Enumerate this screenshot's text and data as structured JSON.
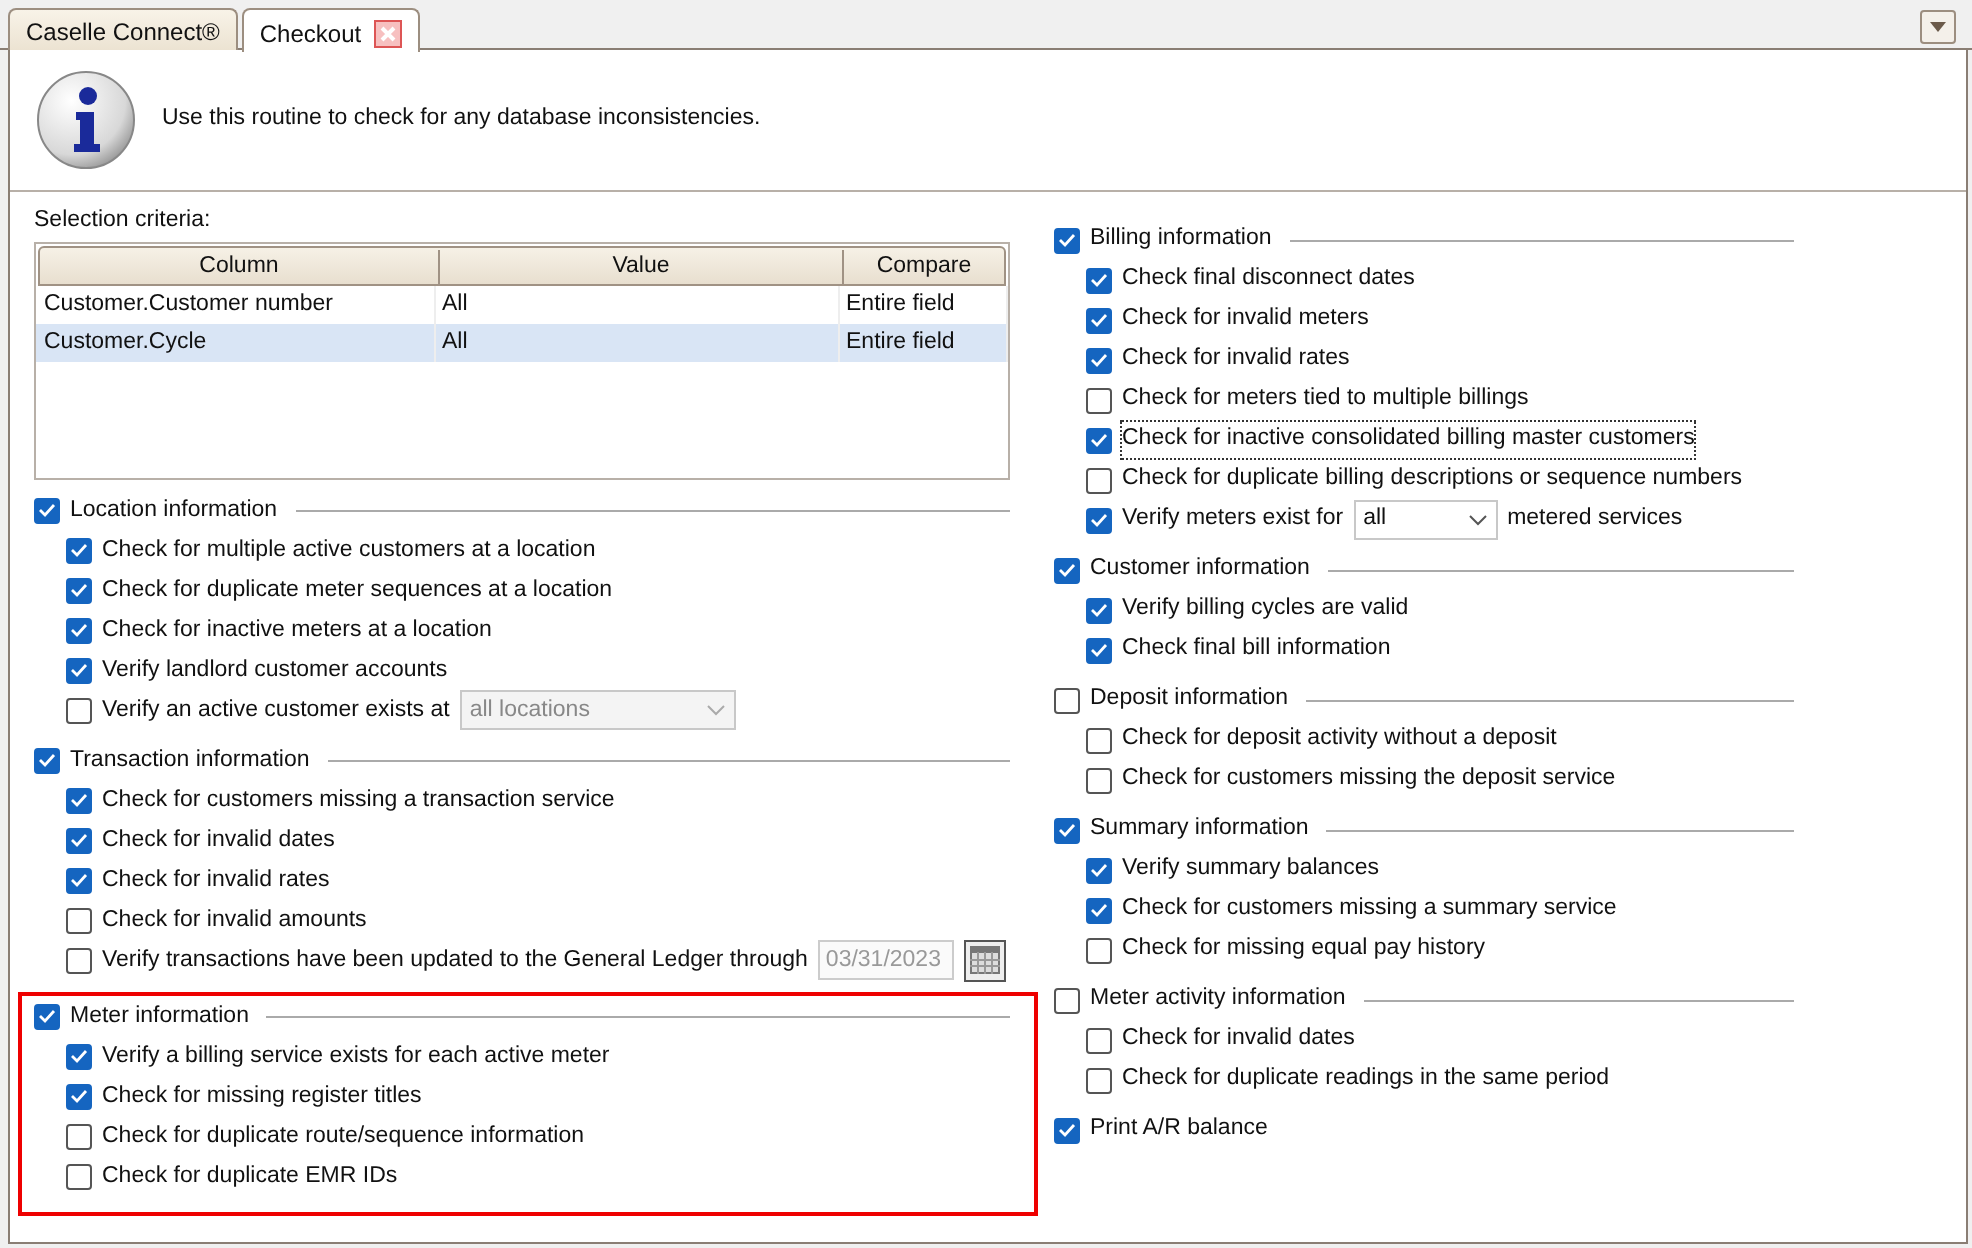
{
  "tabs": [
    {
      "label": "Caselle Connect®",
      "selected": false,
      "closable": false
    },
    {
      "label": "Checkout",
      "selected": true,
      "closable": true
    }
  ],
  "intro": {
    "text": "Use this routine to check for any database inconsistencies."
  },
  "selection_criteria": {
    "label": "Selection criteria:",
    "columns": [
      "Column",
      "Value",
      "Compare"
    ],
    "rows": [
      {
        "cells": [
          "Customer.Customer number",
          "All",
          "Entire field"
        ],
        "selected": false
      },
      {
        "cells": [
          "Customer.Cycle",
          "All",
          "Entire field"
        ],
        "selected": true
      }
    ]
  },
  "left_sections": [
    {
      "label": "Location information",
      "checked": true,
      "highlighted": false,
      "items": [
        {
          "kind": "check",
          "label": "Check for multiple active customers at a location",
          "checked": true
        },
        {
          "kind": "check",
          "label": "Check for duplicate meter sequences at a location",
          "checked": true
        },
        {
          "kind": "check",
          "label": "Check for inactive meters at a location",
          "checked": true
        },
        {
          "kind": "check",
          "label": "Verify landlord customer accounts",
          "checked": true
        },
        {
          "kind": "select",
          "label": "Verify an active customer exists at",
          "checked": false,
          "value": "all locations",
          "disabled": true
        }
      ]
    },
    {
      "label": "Transaction information",
      "checked": true,
      "highlighted": false,
      "items": [
        {
          "kind": "check",
          "label": "Check for customers missing a transaction service",
          "checked": true
        },
        {
          "kind": "check",
          "label": "Check for invalid dates",
          "checked": true
        },
        {
          "kind": "check",
          "label": "Check for invalid rates",
          "checked": true
        },
        {
          "kind": "check",
          "label": "Check for invalid amounts",
          "checked": false
        },
        {
          "kind": "date",
          "label": "Verify transactions have been updated to the General Ledger through",
          "checked": false,
          "value": "03/31/2023",
          "disabled": true
        }
      ]
    },
    {
      "label": "Meter information",
      "checked": true,
      "highlighted": true,
      "items": [
        {
          "kind": "check",
          "label": "Verify a billing service exists for each active meter",
          "checked": true
        },
        {
          "kind": "check",
          "label": "Check for missing register titles",
          "checked": true
        },
        {
          "kind": "check",
          "label": "Check for duplicate route/sequence information",
          "checked": false
        },
        {
          "kind": "check",
          "label": "Check for duplicate EMR IDs",
          "checked": false
        }
      ]
    }
  ],
  "right_sections": [
    {
      "label": "Billing information",
      "checked": true,
      "highlighted": false,
      "items": [
        {
          "kind": "check",
          "label": "Check final disconnect dates",
          "checked": true
        },
        {
          "kind": "check",
          "label": "Check for invalid meters",
          "checked": true
        },
        {
          "kind": "check",
          "label": "Check for invalid rates",
          "checked": true
        },
        {
          "kind": "check",
          "label": "Check for meters tied to multiple billings",
          "checked": false
        },
        {
          "kind": "check",
          "label": "Check for inactive consolidated billing master customers",
          "checked": true,
          "focused": true
        },
        {
          "kind": "check",
          "label": "Check for duplicate billing descriptions or sequence numbers",
          "checked": false
        },
        {
          "kind": "select",
          "label": "Verify meters exist for",
          "checked": true,
          "value": "all",
          "disabled": false,
          "suffix": "metered services"
        }
      ]
    },
    {
      "label": "Customer information",
      "checked": true,
      "highlighted": false,
      "items": [
        {
          "kind": "check",
          "label": "Verify billing cycles are valid",
          "checked": true
        },
        {
          "kind": "check",
          "label": "Check final bill information",
          "checked": true
        }
      ]
    },
    {
      "label": "Deposit information",
      "checked": false,
      "highlighted": false,
      "items": [
        {
          "kind": "check",
          "label": "Check for deposit activity without a deposit",
          "checked": false
        },
        {
          "kind": "check",
          "label": "Check for customers missing the deposit service",
          "checked": false
        }
      ]
    },
    {
      "label": "Summary information",
      "checked": true,
      "highlighted": false,
      "items": [
        {
          "kind": "check",
          "label": "Verify summary balances",
          "checked": true
        },
        {
          "kind": "check",
          "label": "Check for customers missing a summary service",
          "checked": true
        },
        {
          "kind": "check",
          "label": "Check for missing equal pay history",
          "checked": false
        }
      ]
    },
    {
      "label": "Meter activity information",
      "checked": false,
      "highlighted": false,
      "items": [
        {
          "kind": "check",
          "label": "Check for invalid dates",
          "checked": false
        },
        {
          "kind": "check",
          "label": "Check for duplicate readings in the same period",
          "checked": false
        }
      ]
    },
    {
      "label": "Print A/R balance",
      "checked": true,
      "highlighted": false
    }
  ]
}
